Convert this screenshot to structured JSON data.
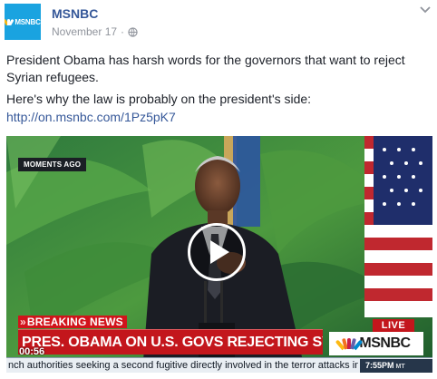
{
  "post": {
    "page_name": "MSNBC",
    "date": "November 17",
    "separator": "·",
    "avatar_text": "MSNBC",
    "message_line1": "President Obama has harsh words for the governors that want to reject Syrian refugees.",
    "message_line2": "Here's why the law is probably on the president's side:",
    "link_text": "http://on.msnbc.com/1Pz5pK7"
  },
  "video": {
    "moments_badge": "MOMENTS AGO",
    "breaking_arrows": "»",
    "breaking_label": "BREAKING NEWS",
    "headline": "PRES. OBAMA ON U.S. GOVS REJECTING SYRIAN REFUGEES",
    "elapsed": "00:56",
    "live_label": "LIVE",
    "network_logo": "MSNBC",
    "ticker_text": "nch authorities seeking a second fugitive directly involved in the terror attacks in P",
    "ticker_time": "7:55PM",
    "ticker_tz": "MT"
  },
  "colors": {
    "link": "#365899",
    "breaking_red": "#d1141b",
    "msnbc_blue": "#1aa3e0"
  },
  "icons": {
    "privacy": "globe-icon",
    "menu": "chevron-down-icon",
    "play": "play-icon"
  }
}
